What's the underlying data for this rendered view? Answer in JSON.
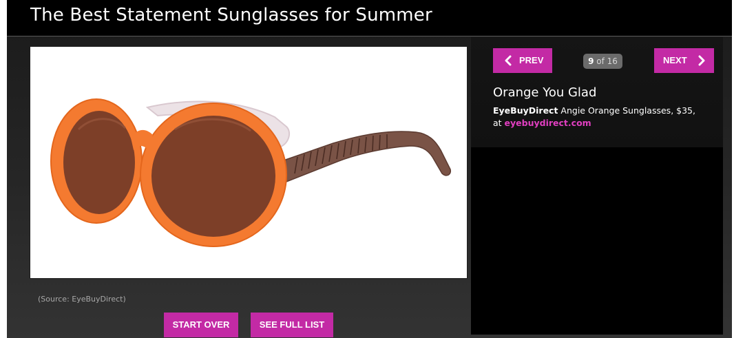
{
  "header": {
    "title": "The Best Statement Sunglasses for Summer"
  },
  "slideshow": {
    "image_alt": "Orange round sunglasses with brown lenses and striped brown temples",
    "source": "(Source: EyeBuyDirect)",
    "current": "9",
    "of_label": "of 16",
    "prev_label": "PREV",
    "next_label": "NEXT",
    "start_over_label": "START OVER",
    "see_full_list_label": "SEE FULL LIST"
  },
  "item": {
    "title": "Orange You Glad",
    "brand": "EyeBuyDirect",
    "description": "Angie Orange Sunglasses, $35,",
    "at": "at",
    "link_text": "eyebuydirect.com"
  },
  "colors": {
    "accent": "#c32aa5",
    "link": "#e13fc1",
    "frame": "#f47a30",
    "lens": "#7d3f28"
  }
}
